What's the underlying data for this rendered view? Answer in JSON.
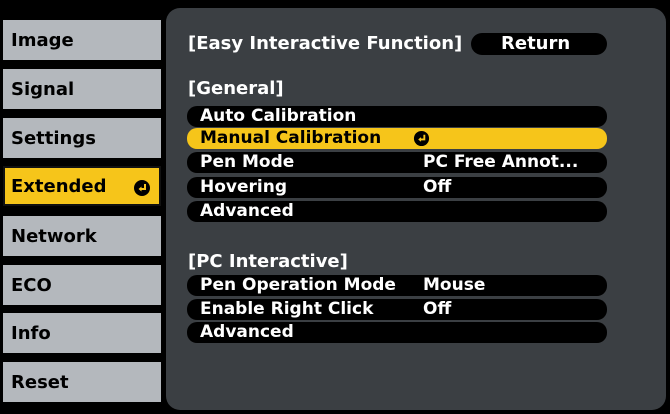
{
  "sidebar": {
    "items": [
      {
        "label": "Image"
      },
      {
        "label": "Signal"
      },
      {
        "label": "Settings"
      },
      {
        "label": "Extended"
      },
      {
        "label": "Network"
      },
      {
        "label": "ECO"
      },
      {
        "label": "Info"
      },
      {
        "label": "Reset"
      }
    ],
    "active_index": 3
  },
  "panel": {
    "title": "[Easy Interactive Function]",
    "return_label": "Return",
    "general": {
      "header": "[General]",
      "rows": [
        {
          "label": "Auto Calibration",
          "value": ""
        },
        {
          "label": "Manual Calibration",
          "value": ""
        },
        {
          "label": "Pen Mode",
          "value": "PC Free Annot..."
        },
        {
          "label": "Hovering",
          "value": "Off"
        },
        {
          "label": "Advanced",
          "value": ""
        }
      ],
      "selected_index": 1
    },
    "pc_interactive": {
      "header": "[PC Interactive]",
      "rows": [
        {
          "label": "Pen Operation Mode",
          "value": "Mouse"
        },
        {
          "label": "Enable Right Click",
          "value": "Off"
        },
        {
          "label": "Advanced",
          "value": ""
        }
      ]
    }
  },
  "icons": {
    "enter": "enter-return-icon"
  },
  "colors": {
    "highlight": "#f6c51a",
    "tab_bg": "#b4b8bd",
    "panel_bg": "#3b3f43",
    "row_bg": "#000000",
    "text": "#ffffff"
  }
}
